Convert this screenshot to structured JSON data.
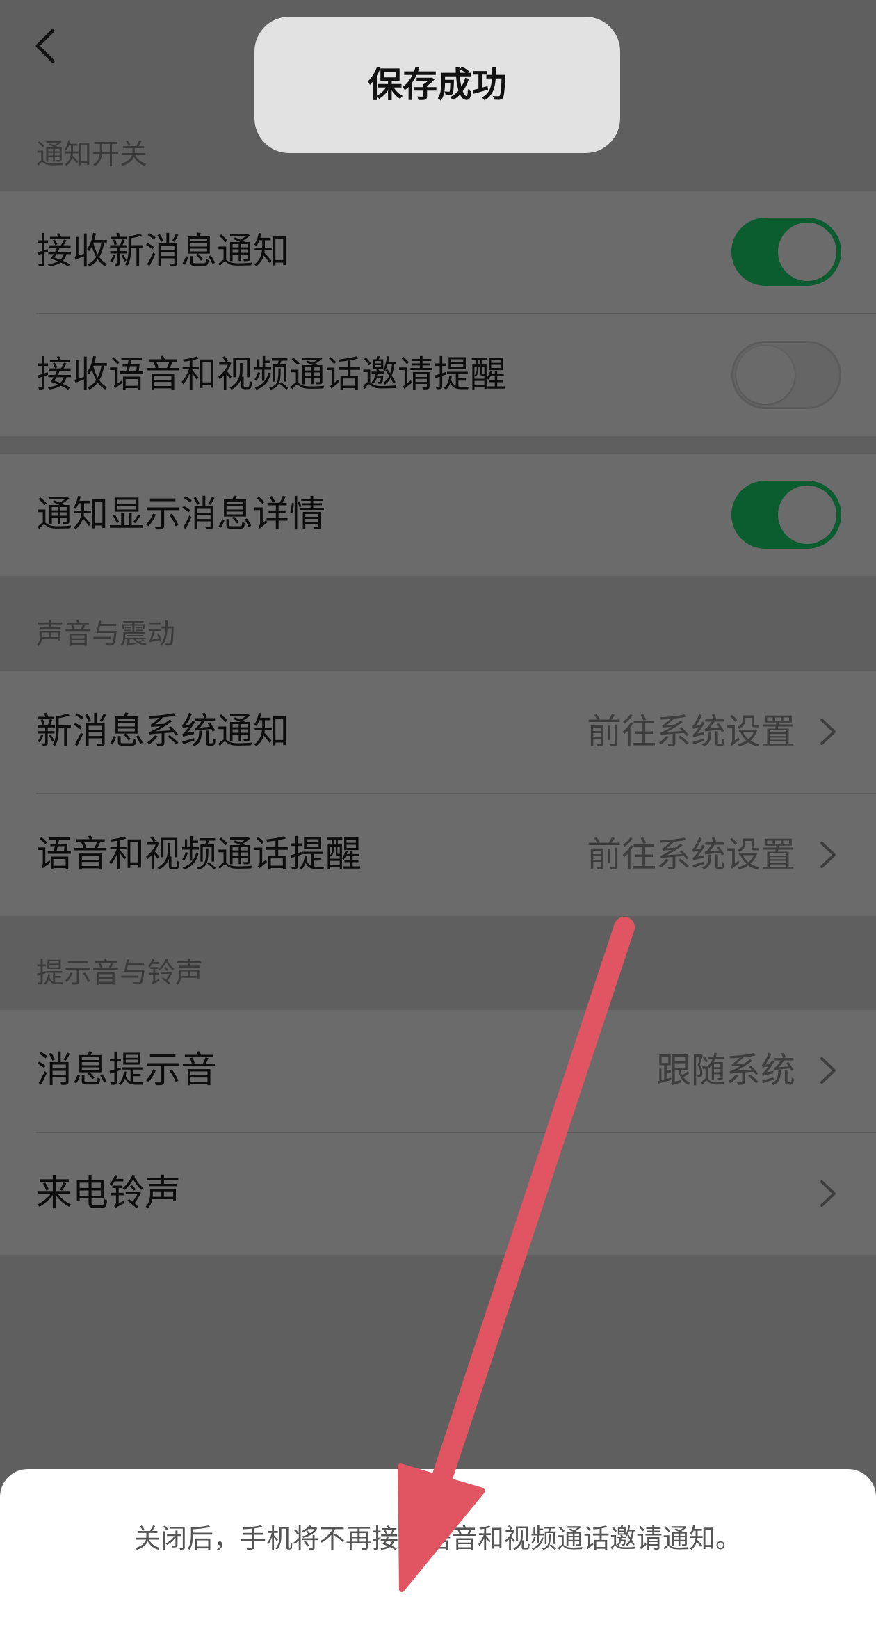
{
  "toast": {
    "text": "保存成功"
  },
  "sections": {
    "notify_switch": {
      "header": "通知开关",
      "rows": [
        {
          "label": "接收新消息通知",
          "toggle": "on"
        },
        {
          "label": "接收语音和视频通话邀请提醒",
          "toggle": "off"
        }
      ]
    },
    "notify_detail": {
      "rows": [
        {
          "label": "通知显示消息详情",
          "toggle": "on"
        }
      ]
    },
    "sound_vibration": {
      "header": "声音与震动",
      "rows": [
        {
          "label": "新消息系统通知",
          "value": "前往系统设置"
        },
        {
          "label": "语音和视频通话提醒",
          "value": "前往系统设置"
        }
      ]
    },
    "tones": {
      "header": "提示音与铃声",
      "rows": [
        {
          "label": "消息提示音",
          "value": "跟随系统"
        },
        {
          "label": "来电铃声",
          "value": ""
        }
      ]
    }
  },
  "sheet": {
    "message": "关闭后，手机将不再接收语音和视频通话邀请通知。"
  },
  "colors": {
    "toggle_on": "#0b5c2f",
    "arrow": "#e05561",
    "overlay": "#5f5f5f"
  },
  "icons": {
    "back": "chevron-left-icon",
    "row_more": "chevron-right-icon",
    "annotation": "arrow-down-icon"
  }
}
